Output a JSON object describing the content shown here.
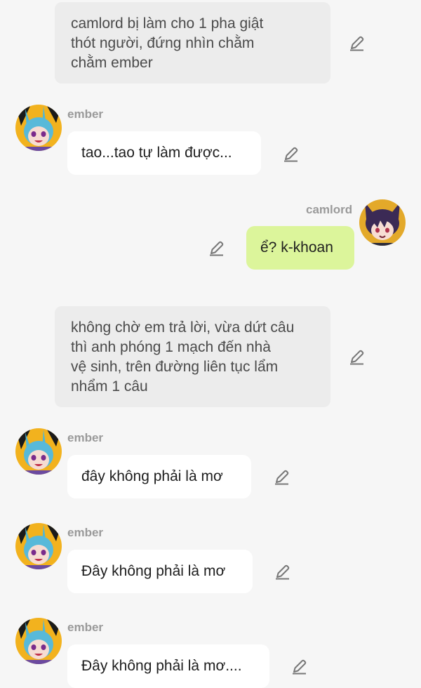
{
  "messages": [
    {
      "type": "narration",
      "lines": [
        "camlord bị làm cho 1 pha giật",
        "thót người, đứng nhìn chằm",
        "chằm ember"
      ]
    },
    {
      "type": "chat",
      "sender": "ember",
      "text": "tao...tao tự làm được..."
    },
    {
      "type": "chat",
      "sender": "camlord",
      "text": "ể? k-khoan"
    },
    {
      "type": "narration",
      "lines": [
        "không chờ em trả lời, vừa dứt câu",
        "thì anh phóng 1 mạch đến nhà",
        "vệ sinh, trên đường liên tục lẩm",
        "nhẩm 1 câu"
      ]
    },
    {
      "type": "chat",
      "sender": "ember",
      "text": "đây không phải là mơ"
    },
    {
      "type": "chat",
      "sender": "ember",
      "text": "Đây không phải là mơ"
    },
    {
      "type": "chat",
      "sender": "ember",
      "text": "Đây không phải là mơ...."
    }
  ],
  "colors": {
    "background": "#f6f6f6",
    "narration_bg": "#ececec",
    "incoming_bubble": "#ffffff",
    "outgoing_bubble": "#dcf59b",
    "sender_name": "#9a9a9a"
  },
  "icons": {
    "edit": "pencil-icon",
    "avatar_ember": "ember-avatar",
    "avatar_camlord": "camlord-avatar"
  }
}
